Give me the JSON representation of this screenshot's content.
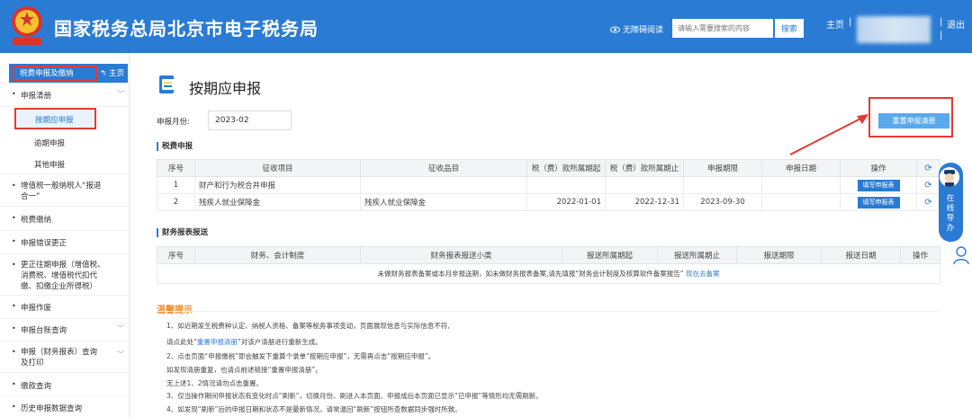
{
  "header": {
    "title": "国家税务总局北京市电子税务局",
    "accessibility": "无障碍阅读",
    "search_placeholder": "请输入需要搜索的内容",
    "search_button": "搜索",
    "home": "主页",
    "separator": "|",
    "logout": "退出",
    "accent": "#2a7bd4"
  },
  "sidebar": {
    "top_label": "税费申报及缴纳",
    "home_label": "主页",
    "items": [
      {
        "label": "申报清册"
      },
      {
        "label": "按期应申报"
      },
      {
        "label": "逾期申报"
      },
      {
        "label": "其他申报"
      },
      {
        "label": "增值税一般纳税人“报退",
        "label2": "合一”"
      },
      {
        "label": "税费缴纳"
      },
      {
        "label": "申报错误更正"
      },
      {
        "label": "更正往期申报（增值税、",
        "label2": "消费税、增值税代扣代",
        "label3": "缴、扣缴企业所得税）"
      },
      {
        "label": "申报作废"
      },
      {
        "label": "申报台账查询"
      },
      {
        "label": "申报（财务报表）查询",
        "label2": "及打印"
      },
      {
        "label": "缴款查询"
      },
      {
        "label": "历史申报数据查询"
      }
    ]
  },
  "main": {
    "title": "按期应申报",
    "month_label": "申报月份:",
    "month_value": "2023-02",
    "reset_button": "重置申报清册",
    "tax_section": "税费申报",
    "tax_headers": [
      "序号",
      "征收项目",
      "征收品目",
      "税（费）款所属期起",
      "税（费）款所属期止",
      "申报期限",
      "申报日期",
      "操作"
    ],
    "tax_rows": [
      {
        "no": "1",
        "item": "财产和行为税合并申报",
        "sub": "",
        "from": "",
        "to": "",
        "deadline": "",
        "date": "",
        "action": "填写申报表"
      },
      {
        "no": "2",
        "item": "残疾人就业保障金",
        "sub": "残疾人就业保障金",
        "from": "2022-01-01",
        "to": "2022-12-31",
        "deadline": "2023-09-30",
        "date": "",
        "action": "填写申报表"
      }
    ],
    "report_section": "财务报表报送",
    "report_headers": [
      "序号",
      "财务、会计制度",
      "财务报表报送小类",
      "报送所属期起",
      "报送所属期止",
      "报送期限",
      "报送日期",
      "操作"
    ],
    "report_note": "未做财务报表备案或本月非报送期，如未做财务报表备案,请先填报“财务会计制度及核算软件备案报告”",
    "report_note_link": "现在去备案"
  },
  "tips": {
    "title": "温馨提示",
    "line1": "1、如近期发生税费种认定、纳税人资格、备案等税务事项变动，页面展现信息与实际信息不符,",
    "line2a": "请点此处“",
    "line2_link": "重置申报清册",
    "line2b": "”对该户清册进行重新生成。",
    "line3": "2、点击页面“申报缴税”即会触发下重算个录单“按期应申报”，无需再点击“按期应申报”。",
    "line4": "如发现清册重复，也请点前述链接“重置申报清册”。",
    "line5": "无上述1、2情况请勿点击重置。",
    "line6": "3、仅当操作期间申报状态有变化时点“刷新”，切换月份、刷进入本页面、申报成后本页面已显示“已申报”等情形均无需刷新。",
    "line7": "4、如发现“刷新”后的申报日期和状态不是最新情况，请常温回“刷新”按钮所查数据同步强时所致。"
  },
  "float": {
    "text": [
      "在",
      "线",
      "导",
      "办"
    ]
  }
}
